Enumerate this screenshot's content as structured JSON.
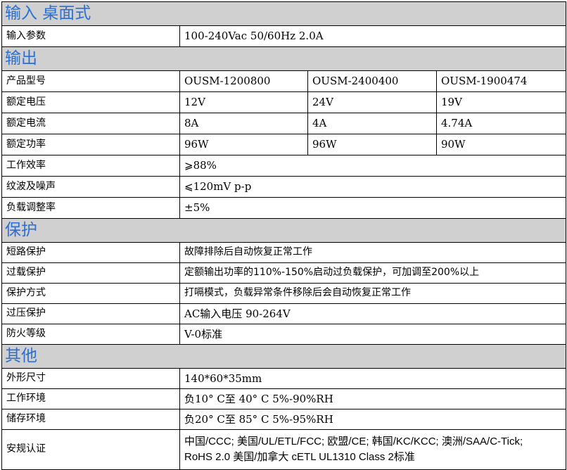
{
  "sections": {
    "input": "输入 桌面式",
    "output": "输出",
    "protection": "保护",
    "other": "其他"
  },
  "input_params": {
    "label": "输入参数",
    "value": "100-240Vac 50/60Hz 2.0A"
  },
  "output_table": {
    "model": {
      "label": "产品型号",
      "values": [
        "OUSM-1200800",
        "OUSM-2400400",
        "OUSM-1900474"
      ]
    },
    "voltage": {
      "label": "额定电压",
      "values": [
        "12V",
        "24V",
        "19V"
      ]
    },
    "current": {
      "label": "额定电流",
      "values": [
        "8A",
        "4A",
        "4.74A"
      ]
    },
    "power": {
      "label": "额定功率",
      "values": [
        "96W",
        "96W",
        "90W"
      ]
    },
    "efficiency": {
      "label": "工作效率",
      "value": "⩾88%"
    },
    "ripple": {
      "label": "纹波及噪声",
      "value": "⩽120mV p-p"
    },
    "load_reg": {
      "label": "负载调整率",
      "value": "±5%"
    }
  },
  "protection_table": [
    {
      "label": "短路保护",
      "value": "故障排除后自动恢复正常工作"
    },
    {
      "label": "过载保护",
      "value": "定额输出功率的110%-150%启动过负载保护，可加调至200%以上"
    },
    {
      "label": "保护方式",
      "value": "打嗝模式，负载异常条件移除后会自动恢复正常工作"
    },
    {
      "label": "过压保护",
      "value": "AC输入电压 90-264V"
    },
    {
      "label": "防火等级",
      "value": "V-0标准"
    }
  ],
  "other_table": {
    "dimensions": {
      "label": "外形尺寸",
      "value": "140*60*35mm"
    },
    "work_env": {
      "label": "工作环境",
      "value": "负10° C至 40° C  5%-90%RH"
    },
    "storage_env": {
      "label": "储存环境",
      "value": "负20° C至 85° C  5%-95%RH"
    },
    "certification": {
      "label": "安规认证",
      "line1": "中国/CCC; 美国/UL/ETL/FCC; 欧盟/CE; 韩国/KC/KCC; 澳洲/SAA/C-Tick;",
      "line2": "RoHS 2.0    美国/加拿大 cETL UL1310 Class 2标准"
    }
  },
  "colors": {
    "section_background": "#d0d0d0",
    "section_text": "#2a6fd6",
    "border": "#000000"
  }
}
